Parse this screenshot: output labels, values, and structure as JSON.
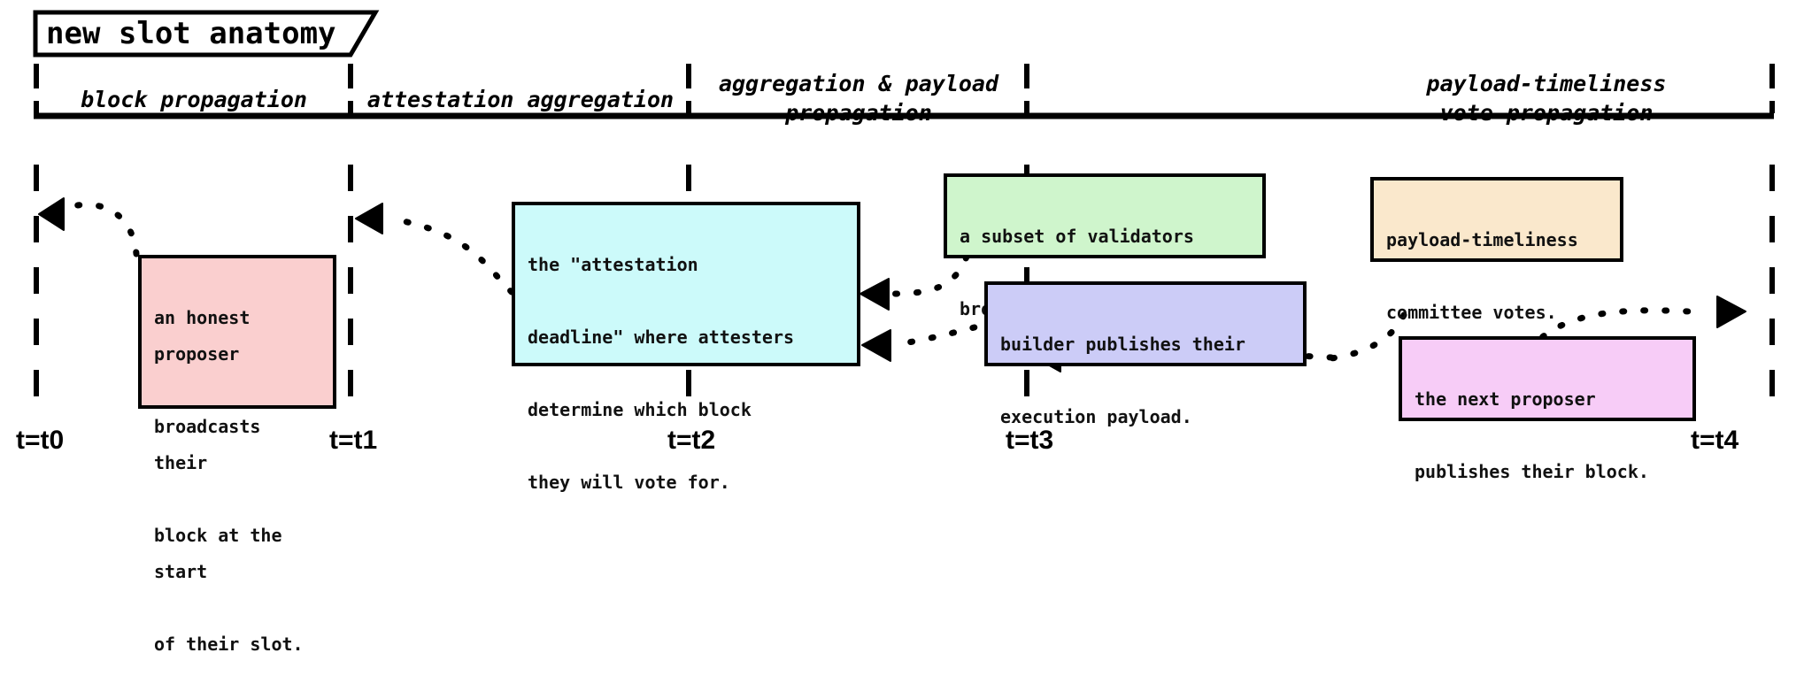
{
  "title": "new slot anatomy",
  "phases": [
    {
      "id": "block-propagation",
      "label": "block propagation"
    },
    {
      "id": "attestation-aggregation",
      "label": "attestation aggregation"
    },
    {
      "id": "aggregation-payload-propagation",
      "label": "aggregation & payload\npropagation"
    },
    {
      "id": "payload-timeliness-vote-propagation",
      "label": "payload-timeliness\nvote propagation"
    }
  ],
  "ticks": [
    {
      "id": "t0",
      "label": "t=t0"
    },
    {
      "id": "t1",
      "label": "t=t1"
    },
    {
      "id": "t2",
      "label": "t=t2"
    },
    {
      "id": "t3",
      "label": "t=t3"
    },
    {
      "id": "t4",
      "label": "t=t4"
    }
  ],
  "notes": [
    {
      "id": "honest-proposer",
      "color": "#FACFCF",
      "lines": [
        "an honest proposer",
        "broadcasts their",
        "block at the start",
        "of their slot."
      ]
    },
    {
      "id": "attestation-deadline",
      "color": "#CCFAFA",
      "lines": [
        "the \"attestation",
        "deadline\" where attesters",
        "determine which block",
        "they will vote for."
      ]
    },
    {
      "id": "validator-aggregate",
      "color": "#CFF5CC",
      "lines": [
        "a subset of validators",
        "broadcast an aggregate."
      ]
    },
    {
      "id": "builder-payload",
      "color": "#CCCCF7",
      "lines": [
        "builder publishes their",
        "execution payload."
      ]
    },
    {
      "id": "ptc-votes",
      "color": "#FAE8CC",
      "lines": [
        "payload-timeliness",
        "committee votes."
      ]
    },
    {
      "id": "next-proposer",
      "color": "#F7CCF7",
      "lines": [
        "the next proposer",
        "publishes their block."
      ]
    }
  ],
  "colors": {
    "stroke": "#000000",
    "background": "#FFFFFF"
  }
}
